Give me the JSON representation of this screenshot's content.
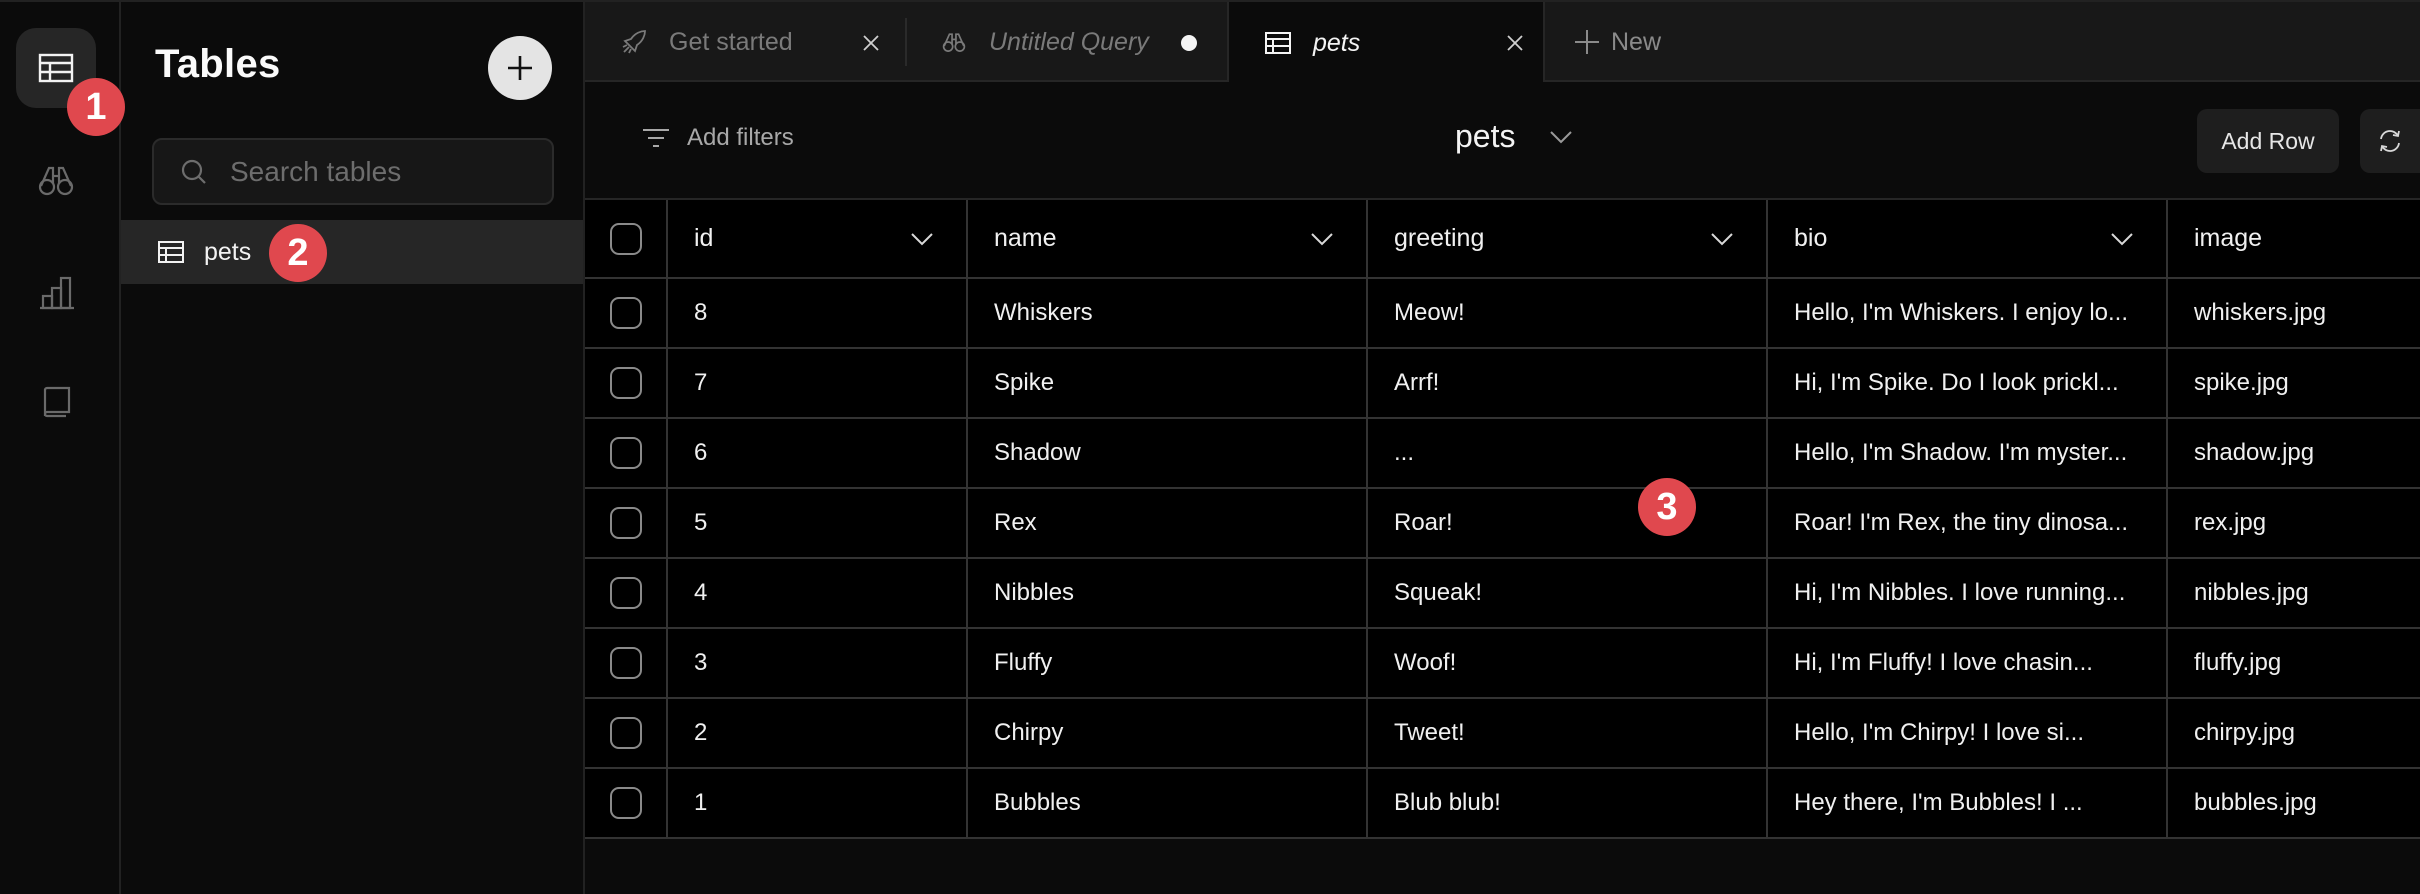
{
  "rail": {
    "items": [
      {
        "name": "tables",
        "icon": "table-icon",
        "active": true
      },
      {
        "name": "queries",
        "icon": "binoculars-icon",
        "active": false
      },
      {
        "name": "charts",
        "icon": "bar-chart-icon",
        "active": false
      },
      {
        "name": "docs",
        "icon": "book-icon",
        "active": false
      }
    ]
  },
  "panel": {
    "title": "Tables",
    "add_icon": "plus-icon",
    "search_placeholder": "Search tables",
    "search_value": "",
    "tables": [
      {
        "label": "pets",
        "icon": "table-icon",
        "selected": true
      }
    ]
  },
  "tabs": [
    {
      "label": "Get started",
      "icon": "rocket-icon",
      "closable": true,
      "active": false
    },
    {
      "label": "Untitled Query",
      "icon": "binoculars-icon",
      "unsaved": true,
      "active": false
    },
    {
      "label": "pets",
      "icon": "table-icon",
      "closable": true,
      "active": true
    },
    {
      "label": "New",
      "icon": "plus-icon",
      "active": false
    }
  ],
  "toolbar": {
    "filters_label": "Add filters",
    "table_selected": "pets",
    "add_row_label": "Add Row",
    "refresh_icon": "refresh-icon"
  },
  "grid": {
    "columns": [
      "id",
      "name",
      "greeting",
      "bio",
      "image"
    ],
    "rows": [
      {
        "id": "8",
        "name": "Whiskers",
        "greeting": "Meow!",
        "bio": "Hello, I'm Whiskers. I enjoy lo...",
        "image": "whiskers.jpg"
      },
      {
        "id": "7",
        "name": "Spike",
        "greeting": "Arrf!",
        "bio": "Hi, I'm Spike. Do I look prickl...",
        "image": "spike.jpg"
      },
      {
        "id": "6",
        "name": "Shadow",
        "greeting": "...",
        "bio": "Hello, I'm Shadow. I'm myster...",
        "image": "shadow.jpg"
      },
      {
        "id": "5",
        "name": "Rex",
        "greeting": "Roar!",
        "bio": "Roar! I'm Rex, the tiny dinosa...",
        "image": "rex.jpg"
      },
      {
        "id": "4",
        "name": "Nibbles",
        "greeting": "Squeak!",
        "bio": "Hi, I'm Nibbles. I love running...",
        "image": "nibbles.jpg"
      },
      {
        "id": "3",
        "name": "Fluffy",
        "greeting": "Woof!",
        "bio": "Hi, I'm Fluffy! I love chasin...",
        "image": "fluffy.jpg"
      },
      {
        "id": "2",
        "name": "Chirpy",
        "greeting": "Tweet!",
        "bio": "Hello, I'm Chirpy! I love si...",
        "image": "chirpy.jpg"
      },
      {
        "id": "1",
        "name": "Bubbles",
        "greeting": "Blub blub!",
        "bio": "Hey there, I'm Bubbles! I ...",
        "image": "bubbles.jpg"
      }
    ]
  },
  "annotations": [
    {
      "label": "1"
    },
    {
      "label": "2"
    },
    {
      "label": "3"
    }
  ],
  "colors": {
    "badge": "#e0484e",
    "background": "#0b0b0b",
    "grid_background": "#000000",
    "active_item": "#262626"
  }
}
